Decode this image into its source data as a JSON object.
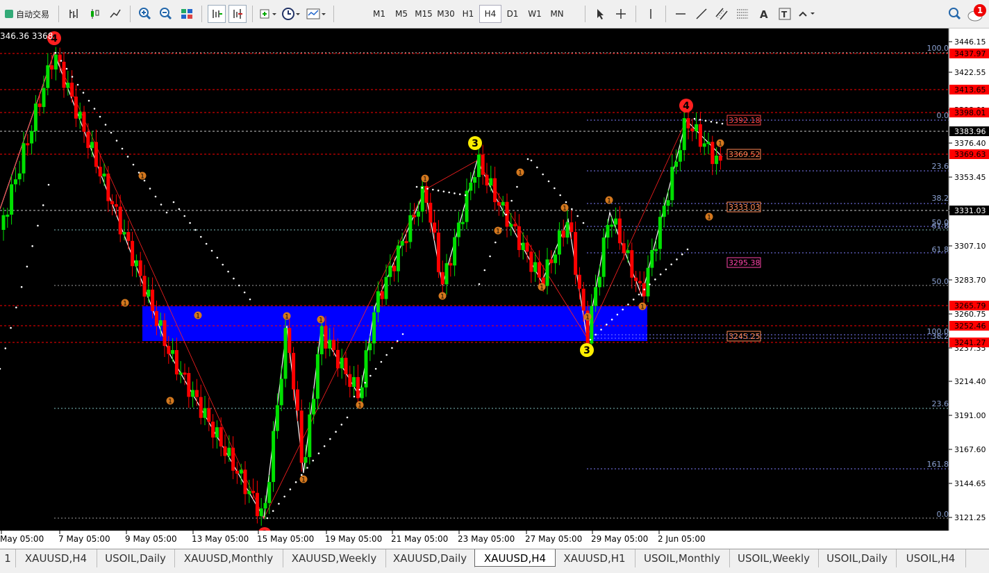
{
  "toolbar": {
    "autotrade_label": "自动交易",
    "timeframes": [
      "M1",
      "M5",
      "M15",
      "M30",
      "H1",
      "H4",
      "D1",
      "W1",
      "MN"
    ],
    "active_timeframe": "H4",
    "notification_count": "1"
  },
  "chart": {
    "top_info": "346.36 3368",
    "price_axis": [
      "3446.15",
      "3422.55",
      "3398.01",
      "3376.40",
      "3353.45",
      "3331.03",
      "3307.10",
      "3283.70",
      "3260.75",
      "3237.35",
      "3214.40",
      "3191.00",
      "3167.60",
      "3144.65",
      "3121.25"
    ],
    "red_price_tags": [
      "3437.97",
      "3413.65",
      "3398.01",
      "3369.63",
      "3265.79",
      "3252.46",
      "3241.27"
    ],
    "white_price_tags": [
      "3383.96",
      "3331.03"
    ],
    "time_axis": [
      "May 05:00",
      "7 May 05:00",
      "9 May 05:00",
      "13 May 05:00",
      "15 May 05:00",
      "19 May 05:00",
      "21 May 05:00",
      "23 May 05:00",
      "27 May 05:00",
      "29 May 05:00",
      "2 Jun 05:00"
    ],
    "fib_labels_right": [
      "100.0",
      "0.0",
      "23.6",
      "38.2",
      "50.0",
      "61.8",
      "61.8",
      "50.0",
      "100.0",
      "38.2",
      "23.6",
      "161.8",
      "0.0"
    ],
    "boxed_prices": [
      "3392.18",
      "3369.52",
      "3333.03",
      "3295.38",
      "3245.25"
    ],
    "wave_labels": [
      "4",
      "3",
      "3",
      "4",
      "1"
    ]
  },
  "colors": {
    "bull": "#00e000",
    "bear": "#ff0000",
    "zone": "#0000ff",
    "wave_badge": "#d4781e",
    "red_tag": "#ff0000"
  },
  "tabs": [
    "1",
    "XAUUSD,H4",
    "USOIL,Daily",
    "XAUUSD,Monthly",
    "XAUUSD,Weekly",
    "XAUUSD,Daily",
    "XAUUSD,H4",
    "XAUUSD,H1",
    "USOIL,Monthly",
    "USOIL,Weekly",
    "USOIL,Daily",
    "USOIL,H4"
  ],
  "active_tab_index": 6
}
